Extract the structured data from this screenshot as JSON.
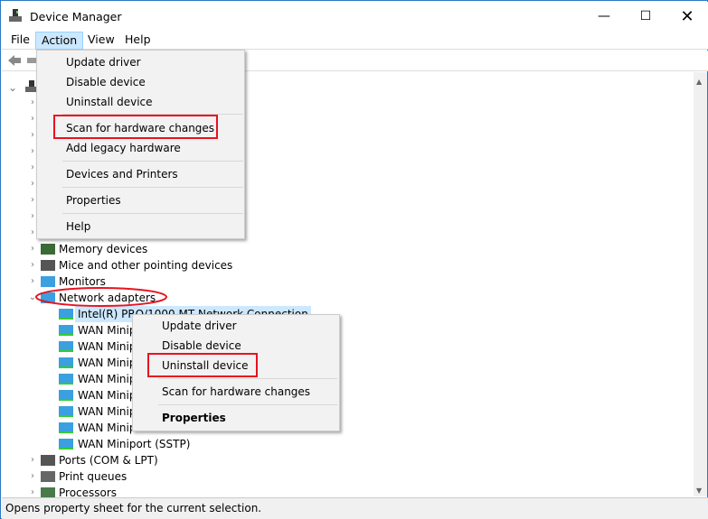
{
  "window": {
    "title": "Device Manager",
    "controls": [
      "minimize",
      "maximize",
      "close"
    ]
  },
  "menubar": {
    "items": [
      "File",
      "Action",
      "View",
      "Help"
    ],
    "active": "Action"
  },
  "toolbar": {
    "icons": [
      "back-arrow-icon",
      "forward-arrow-icon"
    ]
  },
  "tree": {
    "categories": [
      {
        "label": "Memory devices",
        "icon": "memory-icon",
        "expanded": false
      },
      {
        "label": "Mice and other pointing devices",
        "icon": "mouse-icon",
        "expanded": false
      },
      {
        "label": "Monitors",
        "icon": "monitor-icon",
        "expanded": false
      },
      {
        "label": "Network adapters",
        "icon": "network-adapter-icon",
        "expanded": true
      },
      {
        "label": "Ports (COM & LPT)",
        "icon": "port-icon",
        "expanded": false
      },
      {
        "label": "Print queues",
        "icon": "printer-icon",
        "expanded": false
      },
      {
        "label": "Processors",
        "icon": "processor-icon",
        "expanded": false
      }
    ],
    "network_children": [
      "Intel(R) PRO/1000 MT Network Connection",
      "WAN Minip",
      "WAN Minip",
      "WAN Minip",
      "WAN Minip",
      "WAN Minip",
      "WAN Minip",
      "WAN Minip",
      "WAN Miniport (SSTP)"
    ],
    "selected": "Intel(R) PRO/1000 MT Network Connection"
  },
  "action_menu": {
    "items": [
      "Update driver",
      "Disable device",
      "Uninstall device",
      "Scan for hardware changes",
      "Add legacy hardware",
      "Devices and Printers",
      "Properties",
      "Help"
    ],
    "highlighted": "Scan for hardware changes"
  },
  "context_menu": {
    "items": [
      "Update driver",
      "Disable device",
      "Uninstall device",
      "Scan for hardware changes",
      "Properties"
    ],
    "highlighted": "Uninstall device",
    "bold": "Properties"
  },
  "status_bar": {
    "text": "Opens property sheet for the current selection."
  },
  "colors": {
    "annotation_red": "#e8121f",
    "selection": "#cce8ff",
    "window_border": "#2b79c2"
  }
}
